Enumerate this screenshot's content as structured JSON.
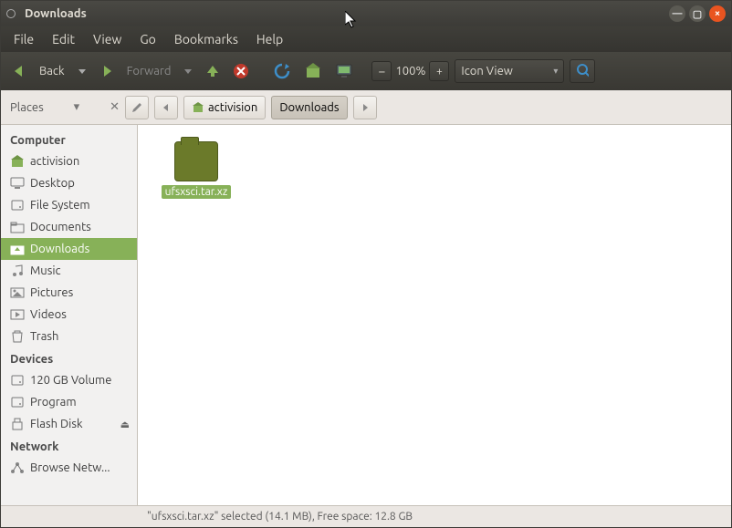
{
  "window": {
    "title": "Downloads"
  },
  "menu": {
    "file": "File",
    "edit": "Edit",
    "view": "View",
    "go": "Go",
    "bookmarks": "Bookmarks",
    "help": "Help"
  },
  "toolbar": {
    "back": "Back",
    "forward": "Forward",
    "zoom": "100%",
    "view_mode": "Icon View"
  },
  "pathbar": {
    "places": "Places",
    "crumb1": "activision",
    "crumb2": "Downloads"
  },
  "sidebar": {
    "sections": {
      "computer": "Computer",
      "devices": "Devices",
      "network": "Network"
    },
    "computer": [
      {
        "label": "activision",
        "icon": "home"
      },
      {
        "label": "Desktop",
        "icon": "desktop"
      },
      {
        "label": "File System",
        "icon": "disk"
      },
      {
        "label": "Documents",
        "icon": "folder"
      },
      {
        "label": "Downloads",
        "icon": "download",
        "selected": true
      },
      {
        "label": "Music",
        "icon": "music"
      },
      {
        "label": "Pictures",
        "icon": "pictures"
      },
      {
        "label": "Videos",
        "icon": "videos"
      },
      {
        "label": "Trash",
        "icon": "trash"
      }
    ],
    "devices": [
      {
        "label": "120 GB Volume",
        "icon": "disk"
      },
      {
        "label": "Program",
        "icon": "disk"
      },
      {
        "label": "Flash Disk",
        "icon": "usb",
        "eject": true
      }
    ],
    "network": [
      {
        "label": "Browse Netw...",
        "icon": "network"
      }
    ]
  },
  "files": [
    {
      "name": "ufsxsci.tar.xz",
      "selected": true
    }
  ],
  "status": "\"ufsxsci.tar.xz\" selected (14.1 MB), Free space: 12.8 GB"
}
